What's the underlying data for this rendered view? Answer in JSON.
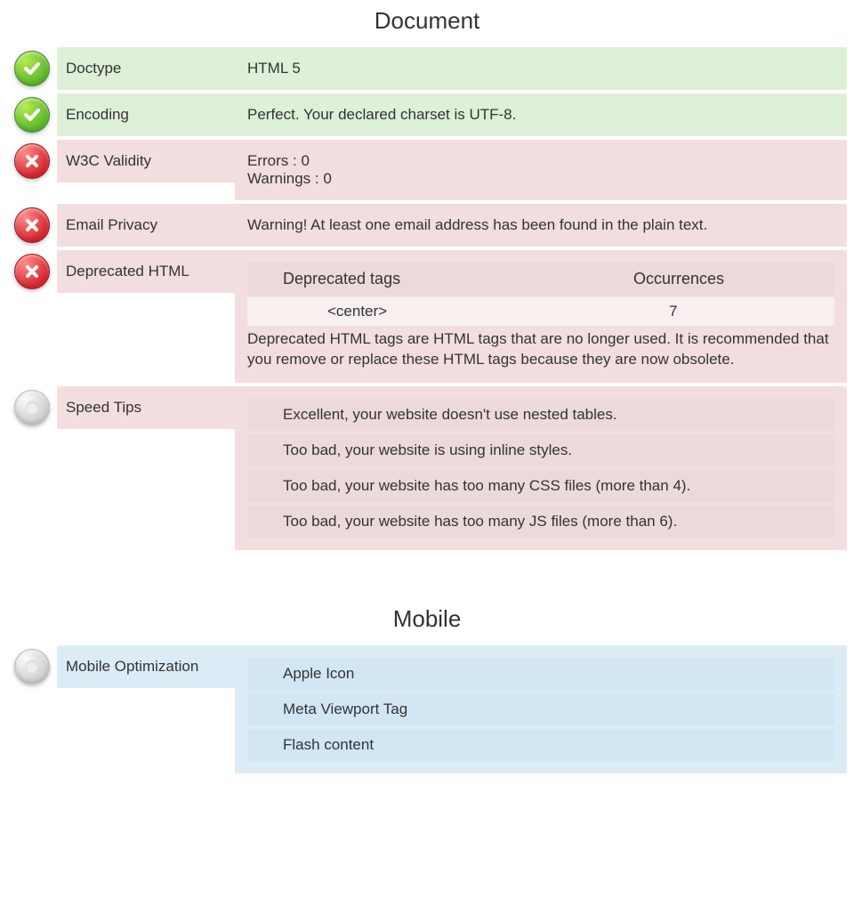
{
  "sections": {
    "document": {
      "title": "Document"
    },
    "mobile": {
      "title": "Mobile"
    }
  },
  "rows": {
    "doctype": {
      "label": "Doctype",
      "value": "HTML 5"
    },
    "encoding": {
      "label": "Encoding",
      "value": "Perfect. Your declared charset is UTF-8."
    },
    "w3c": {
      "label": "W3C Validity",
      "errors": "Errors : 0",
      "warnings": "Warnings : 0"
    },
    "email_privacy": {
      "label": "Email Privacy",
      "value": "Warning! At least one email address has been found in the plain text."
    },
    "deprecated": {
      "label": "Deprecated HTML",
      "header_tags": "Deprecated tags",
      "header_occ": "Occurrences",
      "tag": "<center>",
      "count": "7",
      "note": "Deprecated HTML tags are HTML tags that are no longer used. It is recommended that you remove or replace these HTML tags because they are now obsolete."
    },
    "speed": {
      "label": "Speed Tips",
      "tips": [
        {
          "ok": true,
          "text": "Excellent, your website doesn't use nested tables."
        },
        {
          "ok": false,
          "text": "Too bad, your website is using inline styles."
        },
        {
          "ok": false,
          "text": "Too bad, your website has too many CSS files (more than 4)."
        },
        {
          "ok": false,
          "text": "Too bad, your website has too many JS files (more than 6)."
        }
      ]
    },
    "mobile_opt": {
      "label": "Mobile Optimization",
      "items": [
        {
          "ok": false,
          "text": "Apple Icon"
        },
        {
          "ok": true,
          "text": "Meta Viewport Tag"
        },
        {
          "ok": true,
          "text": "Flash content"
        }
      ]
    }
  }
}
